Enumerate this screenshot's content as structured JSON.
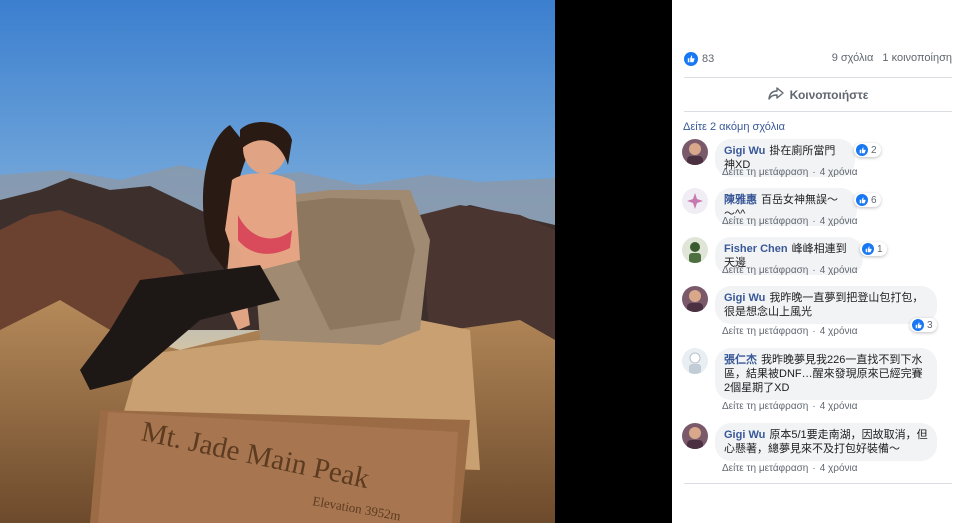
{
  "photo": {
    "sign_title": "Mt. Jade Main Peak",
    "sign_sub": "Elevation 3952m"
  },
  "reactions": {
    "likes": "83",
    "comments": "9 σχόλια",
    "shares": "1 κοινοποίηση"
  },
  "share_label": "Κοινοποιήστε",
  "more_comments": "Δείτε 2 ακόμη σχόλια",
  "colors": {
    "accent": "#1877f2",
    "link": "#385898",
    "bubble": "#f2f3f5"
  },
  "comments": [
    {
      "author": "Gigi Wu",
      "text": "掛在廁所當門神XD",
      "reactions": "2",
      "translate": "Δείτε τη μετάφραση",
      "time": "4 χρόνια"
    },
    {
      "author": "陳雅惠",
      "text": "百岳女神無誤～～^^",
      "reactions": "6",
      "translate": "Δείτε τη μετάφραση",
      "time": "4 χρόνια"
    },
    {
      "author": "Fisher Chen",
      "text": "峰峰相連到天邊",
      "reactions": "1",
      "translate": "Δείτε τη μετάφραση",
      "time": "4 χρόνια"
    },
    {
      "author": "Gigi Wu",
      "text": "我昨晚一直夢到把登山包打包，很是想念山上風光",
      "reactions": "3",
      "translate": "Δείτε τη μετάφραση",
      "time": "4 χρόνια"
    },
    {
      "author": "張仁杰",
      "text": "我昨晚夢見我226一直找不到下水區，結果被DNF…醒來發現原來已經完賽2個星期了XD",
      "reactions": "",
      "translate": "Δείτε τη μετάφραση",
      "time": "4 χρόνια"
    },
    {
      "author": "Gigi Wu",
      "text": "原本5/1要走南湖，因故取消，但心懸著，總夢見來不及打包好裝備～",
      "reactions": "",
      "translate": "Δείτε τη μετάφραση",
      "time": "4 χρόνια"
    }
  ]
}
